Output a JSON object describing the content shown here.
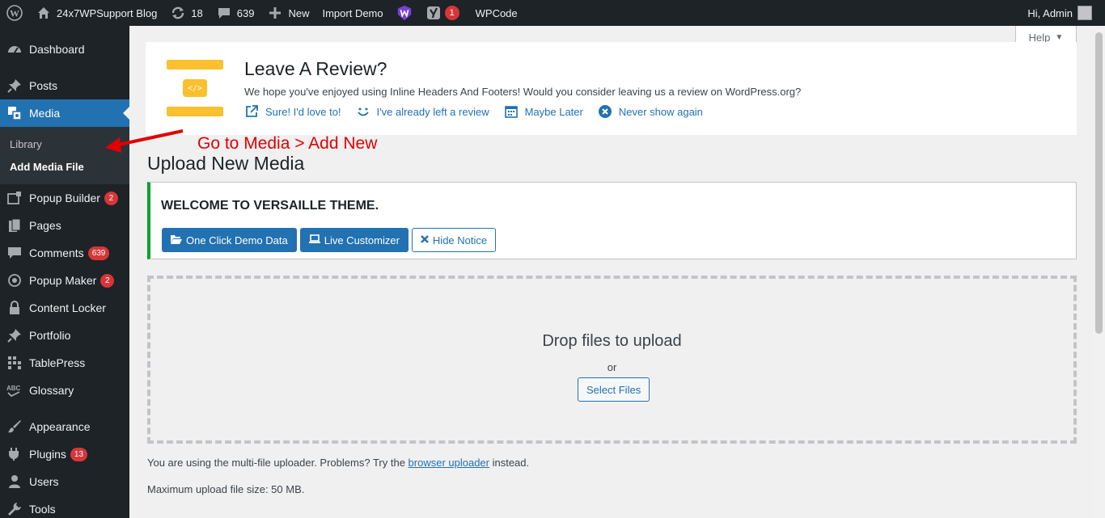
{
  "adminbar": {
    "site_name": "24x7WPSupport Blog",
    "updates_count": "18",
    "comments_count": "639",
    "new_label": "New",
    "import_demo_label": "Import Demo",
    "yoast_count": "1",
    "wpcode_label": "WPCode",
    "greeting": "Hi, Admin"
  },
  "sidebar": {
    "items": [
      {
        "label": "Dashboard",
        "icon": "dashboard-icon"
      },
      {
        "label": "Posts",
        "icon": "pin-icon"
      },
      {
        "label": "Media",
        "icon": "media-icon"
      },
      {
        "label": "Popup Builder",
        "icon": "popup-builder-icon",
        "count": "2"
      },
      {
        "label": "Pages",
        "icon": "pages-icon"
      },
      {
        "label": "Comments",
        "icon": "comment-icon",
        "count": "639"
      },
      {
        "label": "Popup Maker",
        "icon": "popup-maker-icon",
        "count": "2"
      },
      {
        "label": "Content Locker",
        "icon": "lock-icon"
      },
      {
        "label": "Portfolio",
        "icon": "pin-icon"
      },
      {
        "label": "TablePress",
        "icon": "table-icon"
      },
      {
        "label": "Glossary",
        "icon": "abc-icon"
      },
      {
        "label": "Appearance",
        "icon": "brush-icon"
      },
      {
        "label": "Plugins",
        "icon": "plugin-icon",
        "count": "13"
      },
      {
        "label": "Users",
        "icon": "users-icon"
      },
      {
        "label": "Tools",
        "icon": "wrench-icon"
      }
    ],
    "submenu": [
      "Library",
      "Add Media File"
    ]
  },
  "help": {
    "label": "Help"
  },
  "review": {
    "title": "Leave A Review?",
    "message": "We hope you've enjoyed using Inline Headers And Footers! Would you consider leaving us a review on WordPress.org?",
    "logo_code": "</>",
    "actions": [
      "Sure! I'd love to!",
      "I've already left a review",
      "Maybe Later",
      "Never show again"
    ]
  },
  "annotation": {
    "text": "Go to Media > Add New",
    "color": "#e00000"
  },
  "page_title": "Upload New Media",
  "notice": {
    "title": "WELCOME TO VERSAILLE THEME.",
    "buttons": [
      "One Click Demo Data",
      "Live Customizer",
      "Hide Notice"
    ]
  },
  "dropzone": {
    "title": "Drop files to upload",
    "or": "or",
    "select_label": "Select Files"
  },
  "uploader_note": {
    "before": "You are using the multi-file uploader. Problems? Try the ",
    "link": "browser uploader",
    "after": " instead."
  },
  "max_size": "Maximum upload file size: 50 MB.",
  "colors": {
    "accent": "#2271b1",
    "sidebar": "#1d2327",
    "notice_border": "#00a32a",
    "badge": "#d63638"
  }
}
